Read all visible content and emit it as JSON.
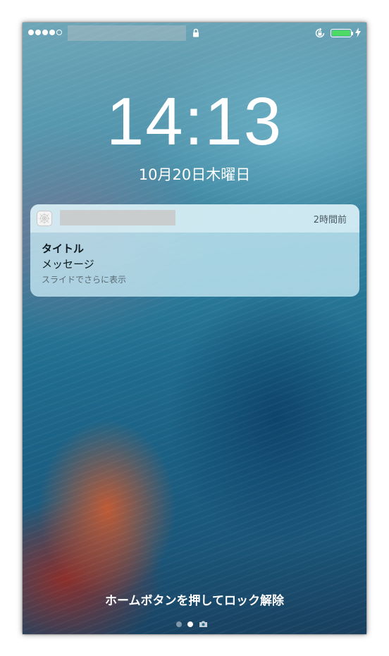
{
  "status_bar": {
    "signal_bars_filled": 4,
    "signal_bars_total": 5,
    "battery_level": 1.0,
    "battery_color": "#4cd964",
    "icons": [
      "signal-dots-icon",
      "lock-icon",
      "rotation-lock-icon",
      "battery-icon",
      "charging-bolt-icon"
    ]
  },
  "lock_screen": {
    "time": "14:13",
    "date": "10月20日木曜日"
  },
  "notification": {
    "app_icon": "app-icon",
    "time_ago": "2時間前",
    "title": "タイトル",
    "message": "メッセージ",
    "hint": "スライドでさらに表示"
  },
  "footer": {
    "unlock_hint": "ホームボタンを押してロック解除",
    "pages": [
      "page-dot",
      "page-dot-current",
      "camera-icon"
    ]
  }
}
